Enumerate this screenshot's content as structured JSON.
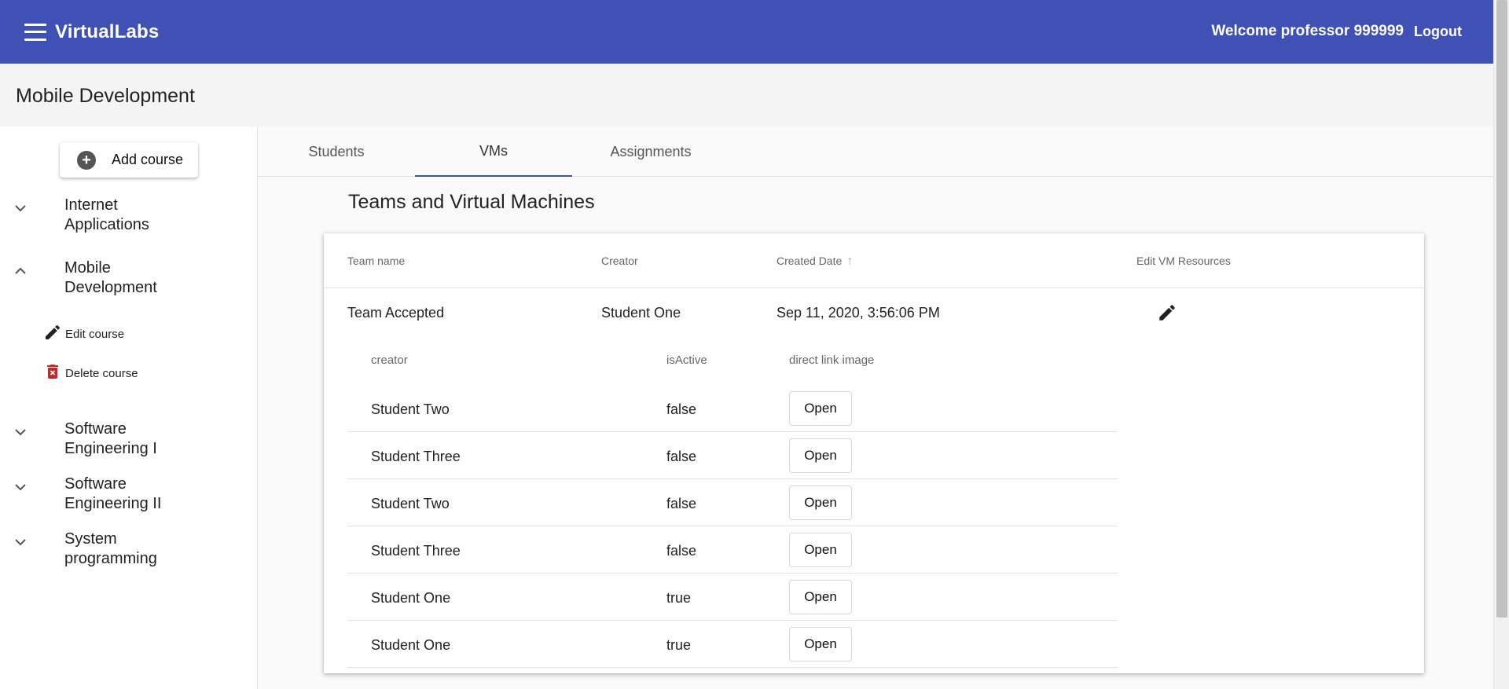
{
  "header": {
    "app_title": "VirtualLabs",
    "welcome": "Welcome professor 999999",
    "logout": "Logout",
    "menu_icon": "menu-icon",
    "brand_color": "#3f51b5"
  },
  "course_header": {
    "title": "Mobile Development"
  },
  "sidebar": {
    "add_course": "Add course",
    "courses": [
      {
        "label_line1": "Internet",
        "label_line2": "Applications",
        "expanded": false
      },
      {
        "label_line1": "Mobile",
        "label_line2": "Development",
        "expanded": true
      },
      {
        "label_line1": "Software",
        "label_line2": "Engineering I",
        "expanded": false
      },
      {
        "label_line1": "Software",
        "label_line2": "Engineering II",
        "expanded": false
      },
      {
        "label_line1": "System",
        "label_line2": "programming",
        "expanded": false
      }
    ],
    "edit_course": "Edit course",
    "delete_course": "Delete course"
  },
  "tabs": {
    "items": [
      {
        "label": "Students"
      },
      {
        "label": "VMs"
      },
      {
        "label": "Assignments"
      }
    ],
    "active": "VMs"
  },
  "main": {
    "section_title": "Teams and Virtual Machines",
    "columns": {
      "team_name": "Team name",
      "creator": "Creator",
      "created_date": "Created Date",
      "edit_vm": "Edit VM Resources"
    },
    "team": {
      "name": "Team Accepted",
      "creator": "Student One",
      "created_date": "Sep 11, 2020, 3:56:06 PM"
    },
    "vm_columns": {
      "creator": "creator",
      "is_active": "isActive",
      "direct_link": "direct link image"
    },
    "vms": [
      {
        "creator": "Student Two",
        "is_active": "false",
        "action": "Open"
      },
      {
        "creator": "Student Three",
        "is_active": "false",
        "action": "Open"
      },
      {
        "creator": "Student Two",
        "is_active": "false",
        "action": "Open"
      },
      {
        "creator": "Student Three",
        "is_active": "false",
        "action": "Open"
      },
      {
        "creator": "Student One",
        "is_active": "true",
        "action": "Open"
      },
      {
        "creator": "Student One",
        "is_active": "true",
        "action": "Open"
      }
    ]
  }
}
